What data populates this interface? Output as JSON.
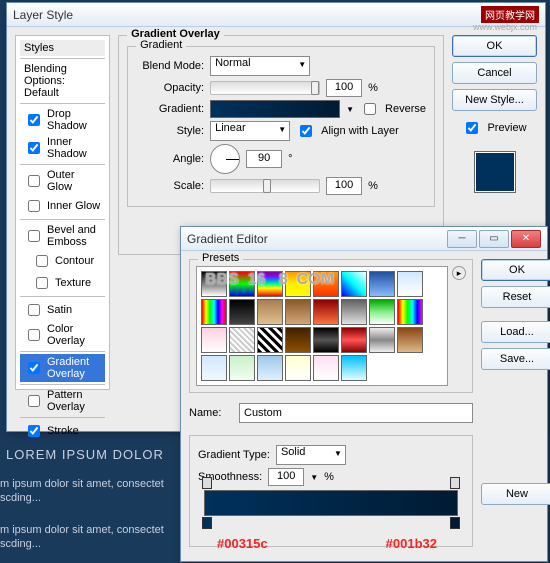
{
  "bg": {
    "title": "LOREM IPSUM DOLOR",
    "line": "m ipsum dolor sit amet, consectet",
    "line2": "scding..."
  },
  "ls": {
    "title": "Layer Style",
    "badge": "网页教学网",
    "watermark": "www.webjx.com",
    "stylesHeader": "Styles",
    "blendingOptions": "Blending Options: Default",
    "items": [
      "Drop Shadow",
      "Inner Shadow",
      "Outer Glow",
      "Inner Glow",
      "Bevel and Emboss",
      "Contour",
      "Texture",
      "Satin",
      "Color Overlay",
      "Gradient Overlay",
      "Pattern Overlay",
      "Stroke"
    ],
    "checked": [
      true,
      true,
      false,
      false,
      false,
      false,
      false,
      false,
      false,
      true,
      false,
      true
    ],
    "go": {
      "section": "Gradient Overlay",
      "subsection": "Gradient",
      "blendModeLabel": "Blend Mode:",
      "blendMode": "Normal",
      "opacityLabel": "Opacity:",
      "opacity": "100",
      "pct": "%",
      "gradientLabel": "Gradient:",
      "reverse": "Reverse",
      "styleLabel": "Style:",
      "style": "Linear",
      "align": "Align with Layer",
      "angleLabel": "Angle:",
      "angle": "90",
      "deg": "°",
      "scaleLabel": "Scale:",
      "scale": "100"
    },
    "buttons": {
      "ok": "OK",
      "cancel": "Cancel",
      "newStyle": "New Style...",
      "preview": "Preview"
    }
  },
  "ge": {
    "title": "Gradient Editor",
    "presets": "Presets",
    "nameLabel": "Name:",
    "name": "Custom",
    "typeLabel": "Gradient Type:",
    "type": "Solid",
    "smoothLabel": "Smoothness:",
    "smooth": "100",
    "pct": "%",
    "hexLeft": "#00315c",
    "hexRight": "#001b32",
    "buttons": {
      "ok": "OK",
      "reset": "Reset",
      "load": "Load...",
      "save": "Save...",
      "new": "New"
    },
    "swatches": [
      "linear-gradient(#000,#fff)",
      "linear-gradient(#f00,#0f0,#00f)",
      "linear-gradient(#808,#80f,#08f,#0f8,#ff0,#f80,#f00)",
      "linear-gradient(#f90,#fe0,#ff0)",
      "linear-gradient(#f90,#f30)",
      "linear-gradient(45deg,#00f,#0ff,#fff)",
      "linear-gradient(#2050a0,#88bbff)",
      "linear-gradient(#cfe8ff,#fff)",
      "linear-gradient(90deg,#f00,#ff0,#0f0,#0ff,#00f,#f0f,#f00)",
      "linear-gradient(#000,#444)",
      "linear-gradient(#a88050,#e0c090)",
      "linear-gradient(#8b5a2b,#d2a679)",
      "linear-gradient(#8b0000,#ff7040)",
      "linear-gradient(#606060,#e0e0e0)",
      "linear-gradient(#0a0,#8e8,#fff)",
      "linear-gradient(90deg,#f00,#ff0,#0f0,#0ff,#00f,#f0f)",
      "linear-gradient(#ffd0e0,#fff)",
      "repeating-linear-gradient(45deg,#fff,#fff 2px,#ccc 2px,#ccc 4px)",
      "repeating-linear-gradient(45deg,#000,#000 3px,#fff 3px,#fff 6px)",
      "linear-gradient(#402000,#905000)",
      "linear-gradient(#000,#555,#000)",
      "linear-gradient(#800,#f55,#800)",
      "linear-gradient(#eee,#888,#eee)",
      "linear-gradient(#8b4513,#deb887)",
      "linear-gradient(#d0e8ff,#f0f8ff)",
      "linear-gradient(#c8f0c8,#f0fff0)",
      "linear-gradient(#a0c8e8,#e0f0ff)",
      "linear-gradient(#ffffd0,#ffffff)",
      "linear-gradient(#ffe0f0,#ffffff)",
      "linear-gradient(#00bfff,#e0ffff)"
    ]
  }
}
